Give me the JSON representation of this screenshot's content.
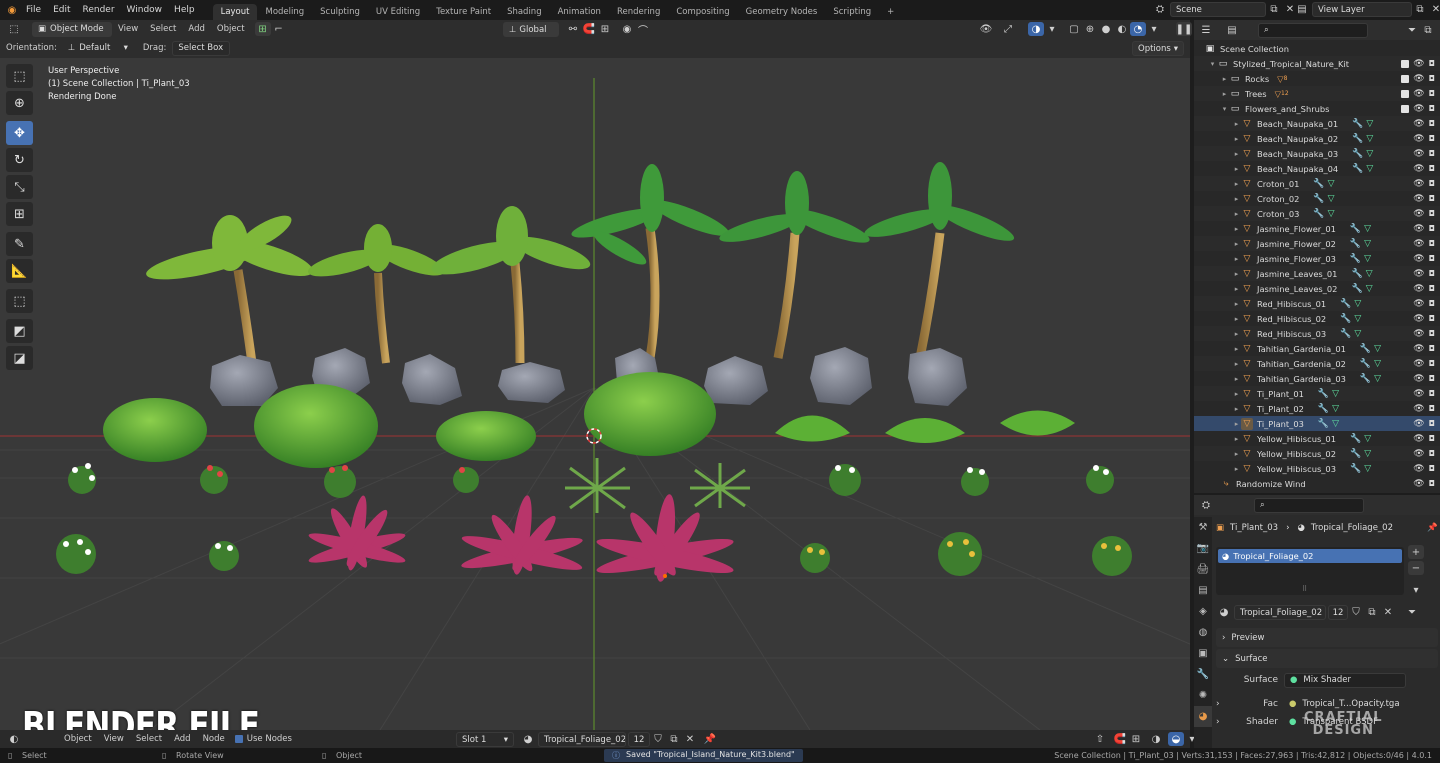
{
  "topbar": {
    "menus": [
      "File",
      "Edit",
      "Render",
      "Window",
      "Help"
    ],
    "workspaces": [
      "Layout",
      "Modeling",
      "Sculpting",
      "UV Editing",
      "Texture Paint",
      "Shading",
      "Animation",
      "Rendering",
      "Compositing",
      "Geometry Nodes",
      "Scripting"
    ],
    "active_workspace": "Layout",
    "scene": "Scene",
    "view_layer": "View Layer"
  },
  "viewport_header": {
    "mode": "Object Mode",
    "menus": [
      "View",
      "Select",
      "Add",
      "Object"
    ],
    "orientation_transform": "Global",
    "orientation_label": "Orientation:",
    "orientation_value": "Default",
    "drag_label": "Drag:",
    "drag_value": "Select Box",
    "options": "Options"
  },
  "viewport_info": {
    "line1": "User Perspective",
    "line2": "(1) Scene Collection | Ti_Plant_03",
    "line3": "Rendering Done"
  },
  "viewport_footer": {
    "items": [
      "Object",
      "View",
      "Select",
      "Add",
      "Node"
    ],
    "use_nodes": "Use Nodes",
    "slot": "Slot 1",
    "material": "Tropical_Foliage_02",
    "users": "12",
    "object": "Object"
  },
  "statusbar": {
    "left1": "Select",
    "left2": "Rotate View",
    "left3": "Object",
    "saved": "Saved \"Tropical_Island_Nature_Kit3.blend\"",
    "right": "Scene Collection | Ti_Plant_03 | Verts:31,153 | Faces:27,963 | Tris:42,812 | Objects:0/46 | 4.0.1"
  },
  "outliner": {
    "root": "Scene Collection",
    "collection": "Stylized_Tropical_Nature_Kit",
    "rocks": {
      "name": "Rocks",
      "count": "8"
    },
    "trees": {
      "name": "Trees",
      "count": "12"
    },
    "flowers": "Flowers_and_Shrubs",
    "objects": [
      "Beach_Naupaka_01",
      "Beach_Naupaka_02",
      "Beach_Naupaka_03",
      "Beach_Naupaka_04",
      "Croton_01",
      "Croton_02",
      "Croton_03",
      "Jasmine_Flower_01",
      "Jasmine_Flower_02",
      "Jasmine_Flower_03",
      "Jasmine_Leaves_01",
      "Jasmine_Leaves_02",
      "Red_Hibiscus_01",
      "Red_Hibiscus_02",
      "Red_Hibiscus_03",
      "Tahitian_Gardenia_01",
      "Tahitian_Gardenia_02",
      "Tahitian_Gardenia_03",
      "Ti_Plant_01",
      "Ti_Plant_02",
      "Ti_Plant_03",
      "Yellow_Hibiscus_01",
      "Yellow_Hibiscus_02",
      "Yellow_Hibiscus_03"
    ],
    "selected": "Ti_Plant_03",
    "randomize": "Randomize Wind"
  },
  "properties": {
    "breadcrumb_object": "Ti_Plant_03",
    "breadcrumb_material": "Tropical_Foliage_02",
    "slot_item": "Tropical_Foliage_02",
    "material_name": "Tropical_Foliage_02",
    "users": "12",
    "preview": "Preview",
    "surface_panel": "Surface",
    "surface_label": "Surface",
    "surface_value": "Mix Shader",
    "fac_label": "Fac",
    "fac_value": "Tropical_T...Opacity.tga",
    "shader_label": "Shader",
    "shader_value": "Transparent BSDF"
  },
  "overlay": {
    "watermark": "BLENDER FILE",
    "logo_line1": "CRAFTIAL",
    "logo_line2": "DESIGN"
  }
}
